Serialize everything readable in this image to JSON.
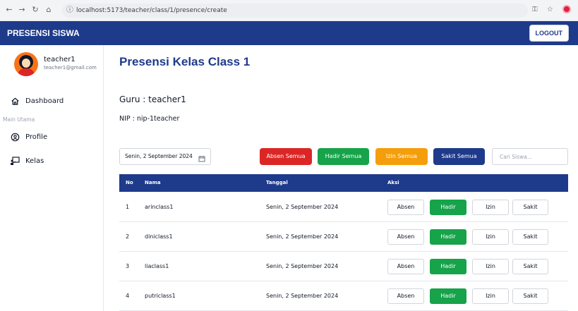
{
  "browser": {
    "url": "localhost:5173/teacher/class/1/presence/create"
  },
  "app": {
    "brand": "PRESENSI SISWA",
    "logout_label": "LOGOUT"
  },
  "user": {
    "name": "teacher1",
    "email": "teacher1@gmail.com"
  },
  "sidebar": {
    "dashboard_label": "Dashboard",
    "section_label": "Main Utama",
    "profile_label": "Profile",
    "kelas_label": "Kelas"
  },
  "main": {
    "title": "Presensi Kelas Class 1",
    "guru": "Guru : teacher1",
    "nip": "NIP : nip-1teacher",
    "date_value": "Senin, 2 September 2024",
    "search_placeholder": "Cari Siswa...",
    "bulk": {
      "absen": "Absen Semua",
      "hadir": "Hadir Semua",
      "izin": "Izin Semua",
      "sakit": "Sakit Semua"
    }
  },
  "colors": {
    "primary": "#1e3a8a",
    "absen_all": "#dc2626",
    "hadir_all": "#16a34a",
    "izin_all": "#f59e0b",
    "sakit_all": "#1e3a8a",
    "hadir_active": "#16a34a"
  },
  "table": {
    "headers": {
      "no": "No",
      "nama": "Nama",
      "tanggal": "Tanggal",
      "aksi": "Aksi"
    },
    "action_labels": {
      "absen": "Absen",
      "hadir": "Hadir",
      "izin": "Izin",
      "sakit": "Sakit"
    },
    "rows": [
      {
        "no": "1",
        "nama": "arinclass1",
        "tanggal": "Senin, 2 September 2024",
        "selected": "Hadir"
      },
      {
        "no": "2",
        "nama": "diniclass1",
        "tanggal": "Senin, 2 September 2024",
        "selected": "Hadir"
      },
      {
        "no": "3",
        "nama": "liaclass1",
        "tanggal": "Senin, 2 September 2024",
        "selected": "Hadir"
      },
      {
        "no": "4",
        "nama": "putriclass1",
        "tanggal": "Senin, 2 September 2024",
        "selected": "Hadir"
      }
    ]
  }
}
